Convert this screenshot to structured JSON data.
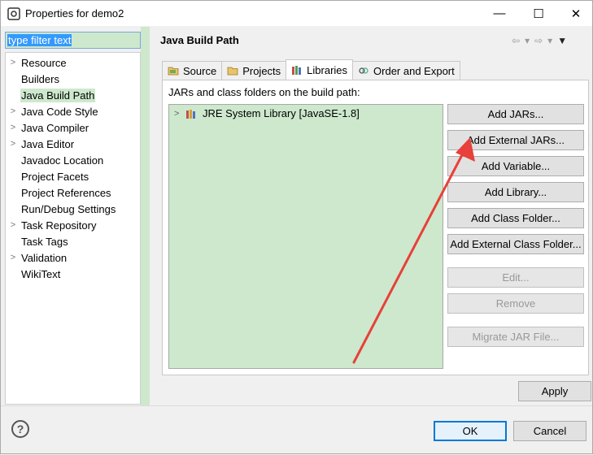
{
  "window": {
    "title": "Properties for demo2",
    "minimize": "—",
    "maximize": "☐",
    "close": "✕"
  },
  "filter": {
    "value": "type filter text"
  },
  "tree": {
    "items": [
      {
        "label": "Resource",
        "expandable": true
      },
      {
        "label": "Builders",
        "expandable": false
      },
      {
        "label": "Java Build Path",
        "expandable": false,
        "selected": true
      },
      {
        "label": "Java Code Style",
        "expandable": true
      },
      {
        "label": "Java Compiler",
        "expandable": true
      },
      {
        "label": "Java Editor",
        "expandable": true
      },
      {
        "label": "Javadoc Location",
        "expandable": false
      },
      {
        "label": "Project Facets",
        "expandable": false
      },
      {
        "label": "Project References",
        "expandable": false
      },
      {
        "label": "Run/Debug Settings",
        "expandable": false
      },
      {
        "label": "Task Repository",
        "expandable": true
      },
      {
        "label": "Task Tags",
        "expandable": false
      },
      {
        "label": "Validation",
        "expandable": true
      },
      {
        "label": "WikiText",
        "expandable": false
      }
    ]
  },
  "page": {
    "title": "Java Build Path",
    "tabs": [
      {
        "label": "Source",
        "icon": "source-folder-icon"
      },
      {
        "label": "Projects",
        "icon": "projects-folder-icon"
      },
      {
        "label": "Libraries",
        "icon": "libraries-icon",
        "active": true
      },
      {
        "label": "Order and Export",
        "icon": "order-export-icon"
      }
    ],
    "caption": "JARs and class folders on the build path:",
    "libraries": [
      {
        "label": "JRE System Library [JavaSE-1.8]",
        "icon": "jre-library-icon"
      }
    ]
  },
  "buttons": {
    "add_jars": "Add JARs...",
    "add_external_jars": "Add External JARs...",
    "add_variable": "Add Variable...",
    "add_library": "Add Library...",
    "add_class_folder": "Add Class Folder...",
    "add_external_class_folder": "Add External Class Folder...",
    "edit": "Edit...",
    "remove": "Remove",
    "migrate_jar": "Migrate JAR File...",
    "apply": "Apply",
    "ok": "OK",
    "cancel": "Cancel",
    "help": "?"
  },
  "colors": {
    "selection_green": "#cde8cd",
    "annotation_arrow": "#e8403a",
    "default_button_border": "#0078d7"
  }
}
